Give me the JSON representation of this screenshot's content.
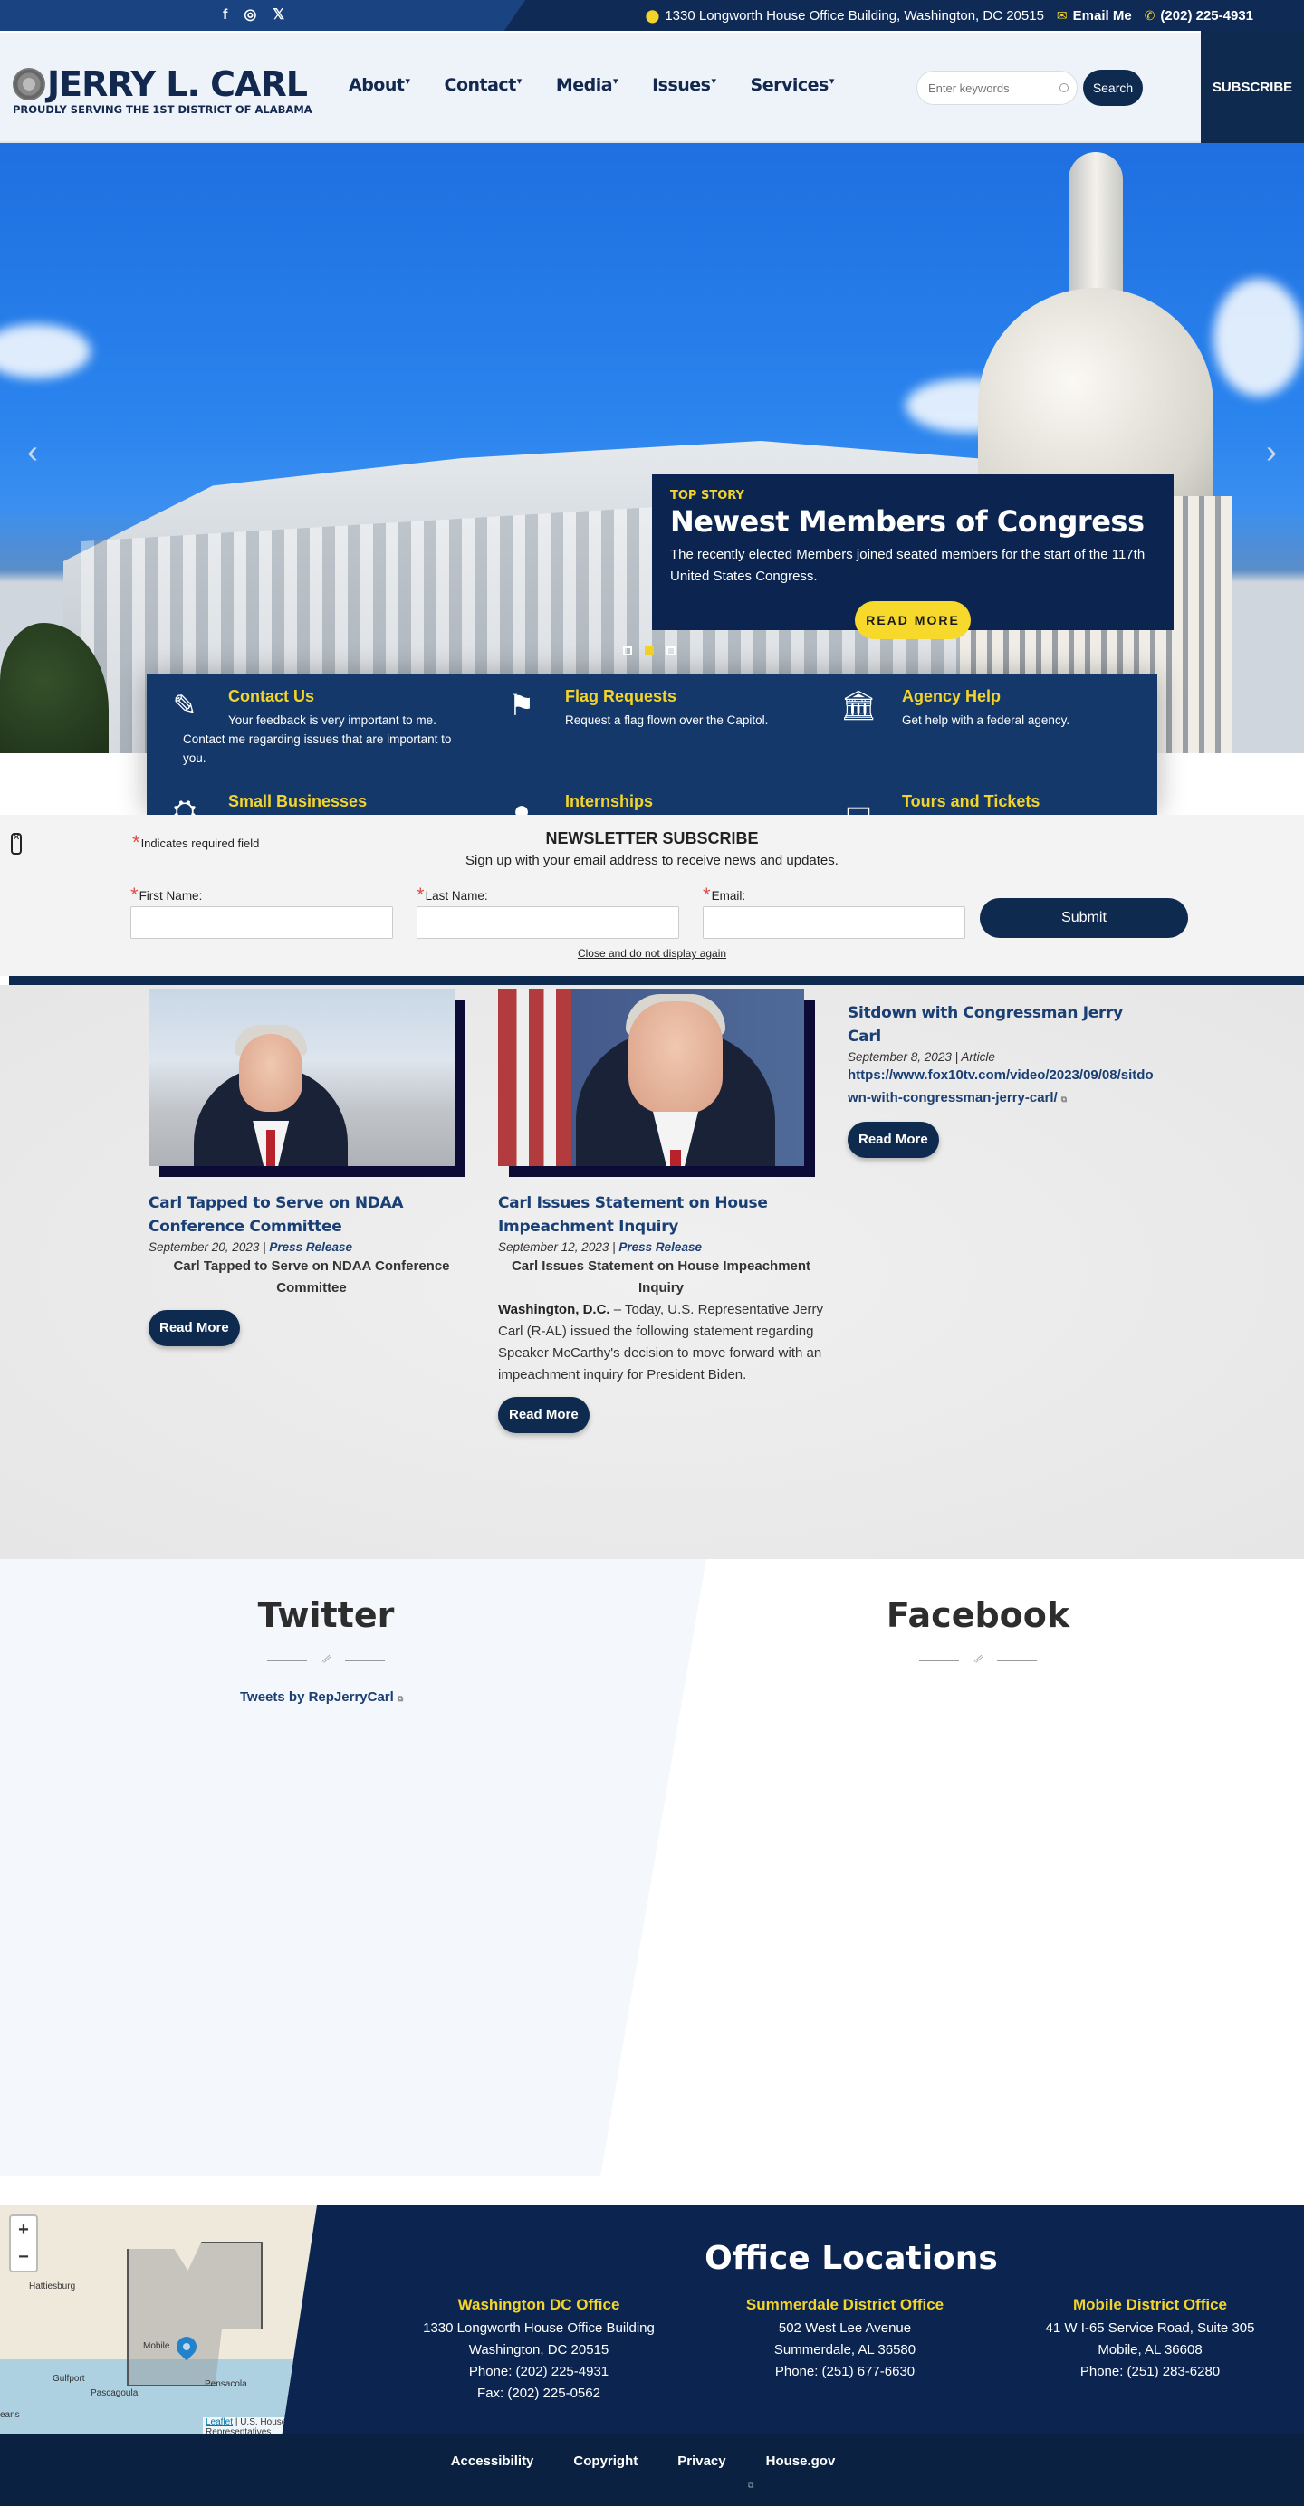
{
  "topbar": {
    "social": [
      {
        "name": "facebook-icon",
        "glyph": "f"
      },
      {
        "name": "instagram-icon",
        "glyph": "◎"
      },
      {
        "name": "x-twitter-icon",
        "glyph": "𝕏"
      }
    ],
    "address": "1330 Longworth House Office Building, Washington, DC 20515",
    "email_label": "Email Me",
    "phone": "(202) 225-4931"
  },
  "header": {
    "logo_name": "JERRY L. CARL",
    "logo_tagline": "PROUDLY SERVING THE 1ST DISTRICT OF ALABAMA",
    "nav": [
      {
        "label": "About"
      },
      {
        "label": "Contact"
      },
      {
        "label": "Media"
      },
      {
        "label": "Issues"
      },
      {
        "label": "Services"
      }
    ],
    "caret": "▾",
    "search_placeholder": "Enter keywords",
    "search_label": "Search",
    "subscribe_label": "SUBSCRIBE"
  },
  "hero": {
    "prev_glyph": "‹",
    "next_glyph": "›",
    "kicker": "TOP STORY",
    "title": "Newest Members of Congress",
    "text": "The recently elected Members joined seated members for the start of the 117th United States Congress.",
    "button": "READ MORE",
    "slides_total": 3,
    "active_slide": 2
  },
  "quick_links": [
    {
      "icon": "edit-icon",
      "glyph": "✎",
      "title": "Contact Us",
      "desc": "Your feedback is very important to me. Contact me regarding issues that are important to you."
    },
    {
      "icon": "flag-icon",
      "glyph": "⚑",
      "title": "Flag Requests",
      "desc": "Request a flag flown over the Capitol."
    },
    {
      "icon": "building-icon",
      "glyph": "🏛",
      "title": "Agency Help",
      "desc": "Get help with a federal agency."
    },
    {
      "icon": "handshake-icon",
      "glyph": "⛭",
      "title": "Small Businesses",
      "desc": ""
    },
    {
      "icon": "user-icon",
      "glyph": "●",
      "title": "Internships",
      "desc": ""
    },
    {
      "icon": "ticket-icon",
      "glyph": "▭",
      "title": "Tours and Tickets",
      "desc": ""
    }
  ],
  "newsletter": {
    "close_glyph": "✕",
    "required_note": "Indicates required field",
    "title": "NEWSLETTER SUBSCRIBE",
    "subtitle": "Sign up with your email address to receive news and updates.",
    "fields": [
      {
        "label": "First Name:",
        "value": ""
      },
      {
        "label": "Last Name:",
        "value": ""
      },
      {
        "label": "Email:",
        "value": ""
      }
    ],
    "submit": "Submit",
    "dismiss": "Close and do not display again"
  },
  "news": [
    {
      "title": "Carl Tapped to Serve on NDAA Conference Committee",
      "date": "September 20, 2023",
      "type": "Press Release",
      "subtitle": "Carl Tapped to Serve on NDAA Conference Committee",
      "button": "Read More"
    },
    {
      "title": "Carl Issues Statement on House Impeachment Inquiry",
      "date": "September 12, 2023",
      "type": "Press Release",
      "subtitle": "Carl Issues Statement on House Impeachment Inquiry",
      "body_lead": "Washington, D.C.",
      "body": " – Today, U.S. Representative Jerry Carl (R-AL) issued the following statement regarding Speaker McCarthy's decision to move forward with an impeachment inquiry for President Biden.",
      "button": "Read More"
    },
    {
      "title": "Sitdown with Congressman Jerry Carl",
      "date": "September 8, 2023",
      "type": "Article",
      "link": "https://www.fox10tv.com/video/2023/09/08/sitdown-with-congressman-jerry-carl/",
      "button": "Read More"
    }
  ],
  "meta_sep": "|",
  "social_section": {
    "twitter_title": "Twitter",
    "twitter_link": "Tweets by RepJerryCarl",
    "facebook_title": "Facebook"
  },
  "map": {
    "zoom_in": "+",
    "zoom_out": "−",
    "labels": [
      "Hattiesburg",
      "Mobile",
      "Gulfport",
      "Pascagoula",
      "Pensacola",
      "eans"
    ],
    "attribution_link": "Leaflet",
    "attribution_text": "| U.S. House of Representatives"
  },
  "offices": {
    "title": "Office Locations",
    "items": [
      {
        "name": "Washington DC Office",
        "lines": [
          "1330 Longworth House Office Building",
          "Washington, DC 20515",
          "Phone: (202) 225-4931",
          "Fax: (202) 225-0562"
        ]
      },
      {
        "name": "Summerdale District Office",
        "lines": [
          "502 West Lee Avenue",
          "Summerdale, AL 36580",
          "Phone: (251) 677-6630"
        ]
      },
      {
        "name": "Mobile District Office",
        "lines": [
          "41 W I-65 Service Road, Suite 305",
          "Mobile, AL 36608",
          "Phone: (251) 283-6280"
        ]
      }
    ]
  },
  "footer": {
    "links": [
      "Accessibility",
      "Copyright",
      "Privacy",
      "House.gov"
    ],
    "ext_glyph": "⧉"
  },
  "colors": {
    "navy": "#0e2a4f",
    "accent_yellow": "#f3d42a",
    "link_blue": "#1a3f74"
  }
}
